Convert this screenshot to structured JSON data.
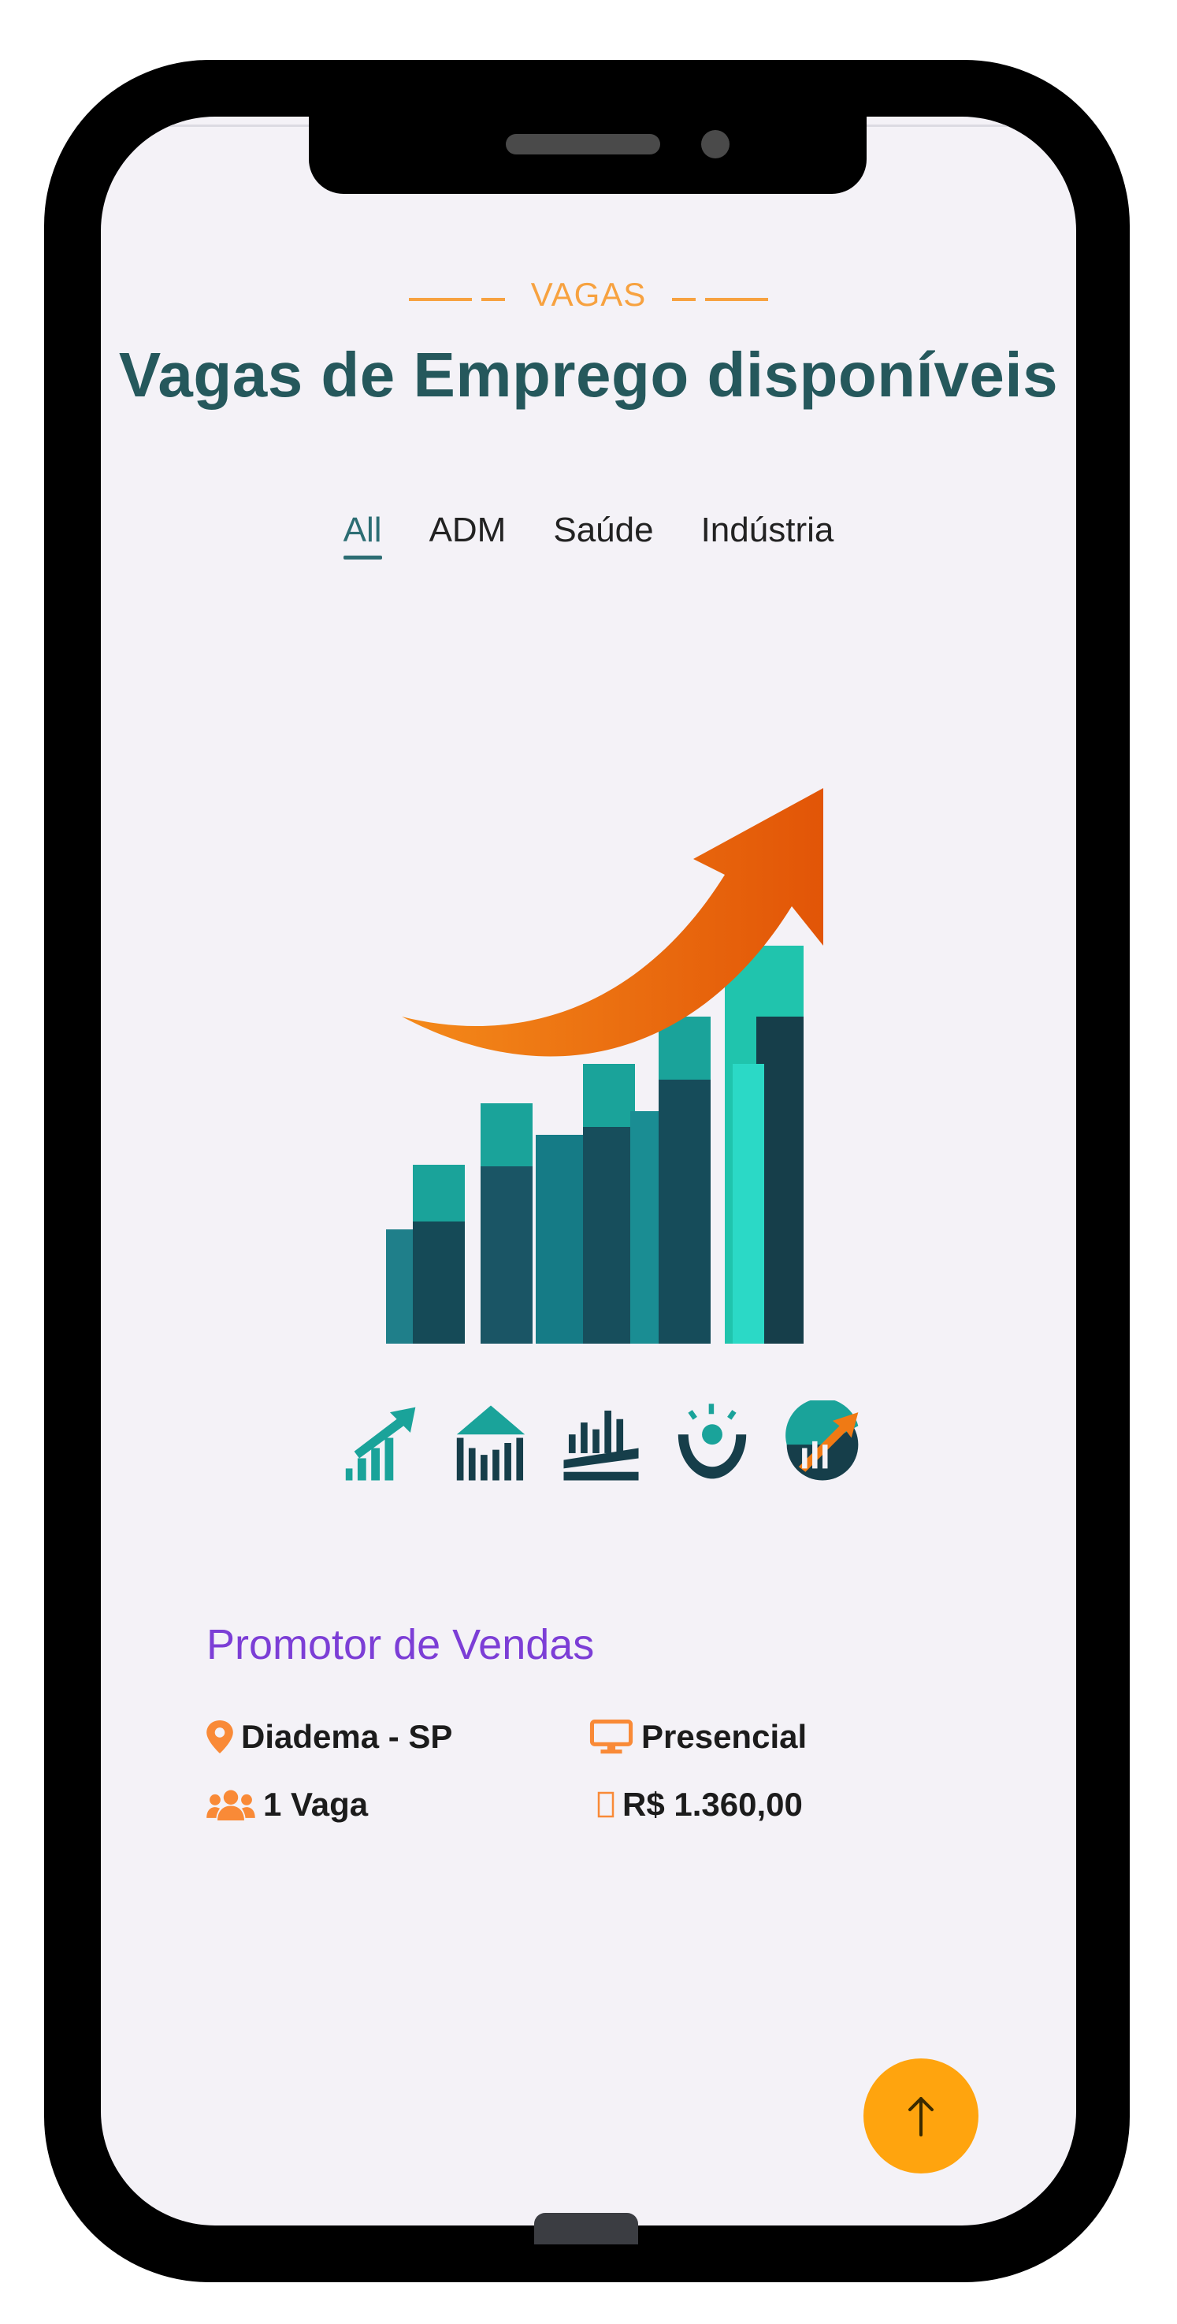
{
  "section": {
    "eyebrow": "VAGAS",
    "title": "Vagas de Emprego disponíveis"
  },
  "tabs": [
    {
      "label": "All",
      "active": true
    },
    {
      "label": "ADM",
      "active": false
    },
    {
      "label": "Saúde",
      "active": false
    },
    {
      "label": "Indústria",
      "active": false
    }
  ],
  "illustration": {
    "icons": [
      "growth-chart-icon",
      "institution-chart-icon",
      "bars-base-icon",
      "hands-support-icon",
      "circle-growth-icon"
    ]
  },
  "job": {
    "title": "Promotor de Vendas",
    "location": "Diadema - SP",
    "mode": "Presencial",
    "vacancies": "1 Vaga",
    "salary": "R$ 1.360,00"
  },
  "colors": {
    "accent_orange": "#f7a240",
    "title_teal": "#25585c",
    "job_purple": "#7c3ed6",
    "fab": "#ffa40e"
  },
  "fab": {
    "icon": "arrow-up-icon"
  }
}
